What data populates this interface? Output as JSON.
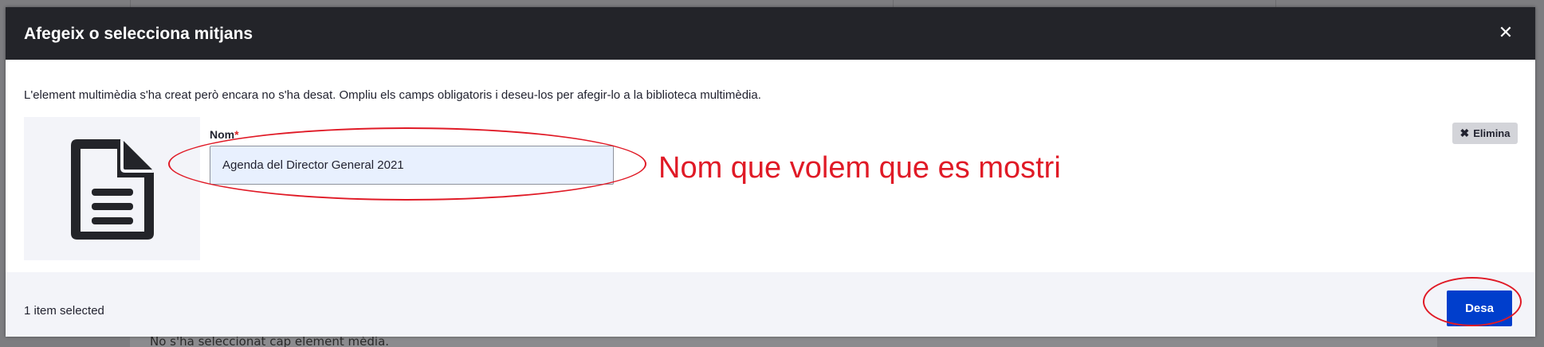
{
  "dialog": {
    "title": "Afegeix o selecciona mitjans",
    "close_icon": "close-icon",
    "message": "L'element multimèdia s'ha creat però encara no s'ha desat. Ompliu els camps obligatoris i deseu-los per afegir-lo a la biblioteca multimèdia."
  },
  "media_item": {
    "thumbnail_icon": "document-icon",
    "name_label": "Nom",
    "required_marker": "*",
    "name_value": "Agenda del Director General 2021",
    "remove_label": "Elimina"
  },
  "annotation": {
    "text": "Nom que volem que es mostri",
    "color": "#e01a26"
  },
  "footer": {
    "selected_count": "1 item selected",
    "save_label": "Desa"
  },
  "background": {
    "text": "No s'ha seleccionat cap element mèdia."
  },
  "colors": {
    "header_bg": "#232429",
    "primary_button": "#003ecc",
    "input_bg": "#e8f0fe"
  }
}
